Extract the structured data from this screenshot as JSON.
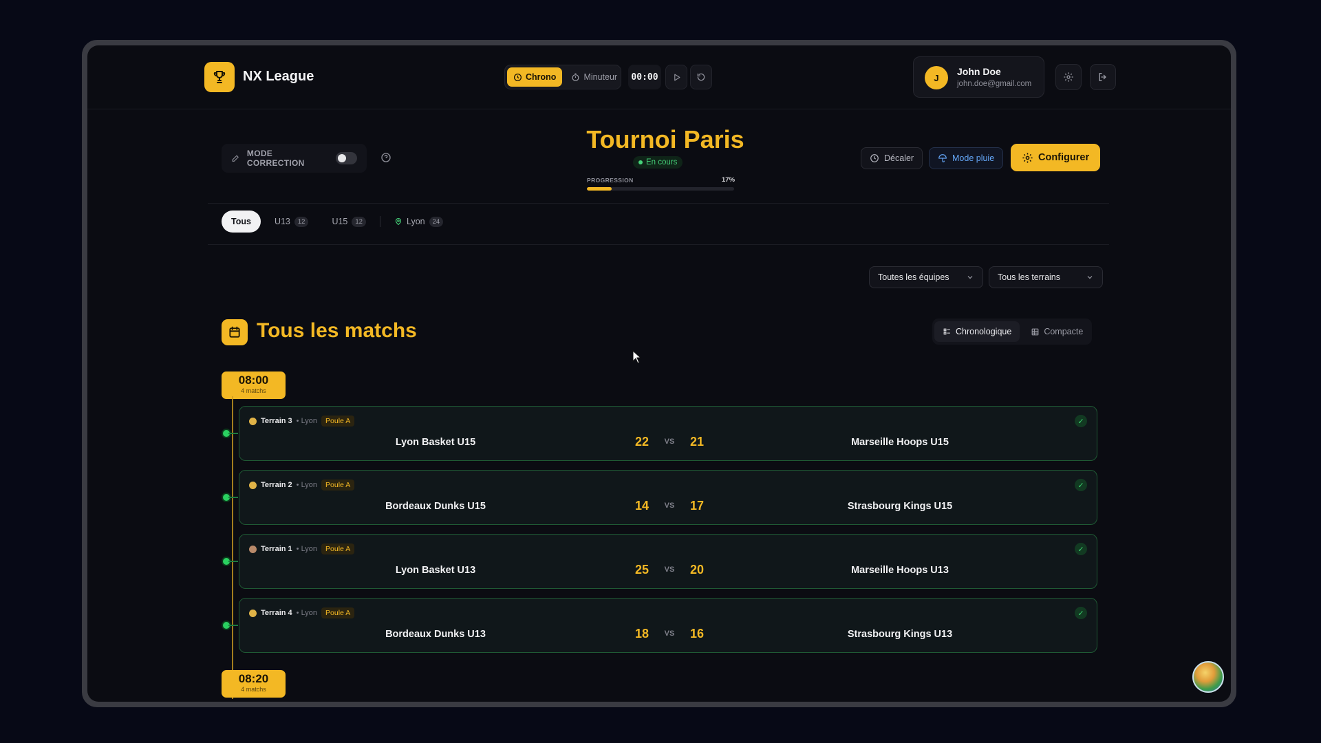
{
  "header": {
    "brand": "NX League",
    "timer_modes": [
      "Chrono",
      "Minuteur"
    ],
    "active_mode": "Chrono",
    "time": "00:00",
    "user": {
      "initial": "J",
      "name": "John Doe",
      "email": "john.doe@gmail.com"
    }
  },
  "tournament": {
    "mode_correction_label": "MODE CORRECTION",
    "mode_correction_on": false,
    "title": "Tournoi Paris",
    "status": "En cours",
    "progress_label": "PROGRESSION",
    "progress_text": "17%",
    "progress_value": 0.17,
    "decaler_label": "Décaler",
    "pluie_label": "Mode pluie",
    "configurer_label": "Configurer"
  },
  "tabs": [
    {
      "label": "Tous",
      "count": ""
    },
    {
      "label": "U13",
      "count": "12"
    },
    {
      "label": "U15",
      "count": "12"
    },
    {
      "label": "Lyon",
      "count": "24"
    }
  ],
  "filters": {
    "teams": "Toutes les équipes",
    "terrains": "Tous les terrains"
  },
  "section": {
    "title": "Tous les matchs",
    "views": [
      "Chronologique",
      "Compacte"
    ],
    "active_view": "Chronologique"
  },
  "slots": [
    {
      "time": "08:00",
      "count": "4 matchs"
    },
    {
      "time": "08:20",
      "count": "4 matchs"
    }
  ],
  "matches": [
    {
      "terrain": "Terrain 3",
      "city": "• Lyon",
      "poule": "Poule A",
      "home": "Lyon Basket U15",
      "home_score": "22",
      "vs": "VS",
      "away_score": "21",
      "away": "Marseille Hoops U15"
    },
    {
      "terrain": "Terrain 2",
      "city": "• Lyon",
      "poule": "Poule A",
      "home": "Bordeaux Dunks U15",
      "home_score": "14",
      "vs": "VS",
      "away_score": "17",
      "away": "Strasbourg Kings U15"
    },
    {
      "terrain": "Terrain 1",
      "city": "• Lyon",
      "poule": "Poule A",
      "home": "Lyon Basket U13",
      "home_score": "25",
      "vs": "VS",
      "away_score": "20",
      "away": "Marseille Hoops U13"
    },
    {
      "terrain": "Terrain 4",
      "city": "• Lyon",
      "poule": "Poule A",
      "home": "Bordeaux Dunks U13",
      "home_score": "18",
      "vs": "VS",
      "away_score": "16",
      "away": "Strasbourg Kings U13"
    }
  ],
  "colors": {
    "accent": "#f3b824",
    "success": "#46d37a",
    "info": "#63a5f5",
    "background": "#0b0c12"
  }
}
